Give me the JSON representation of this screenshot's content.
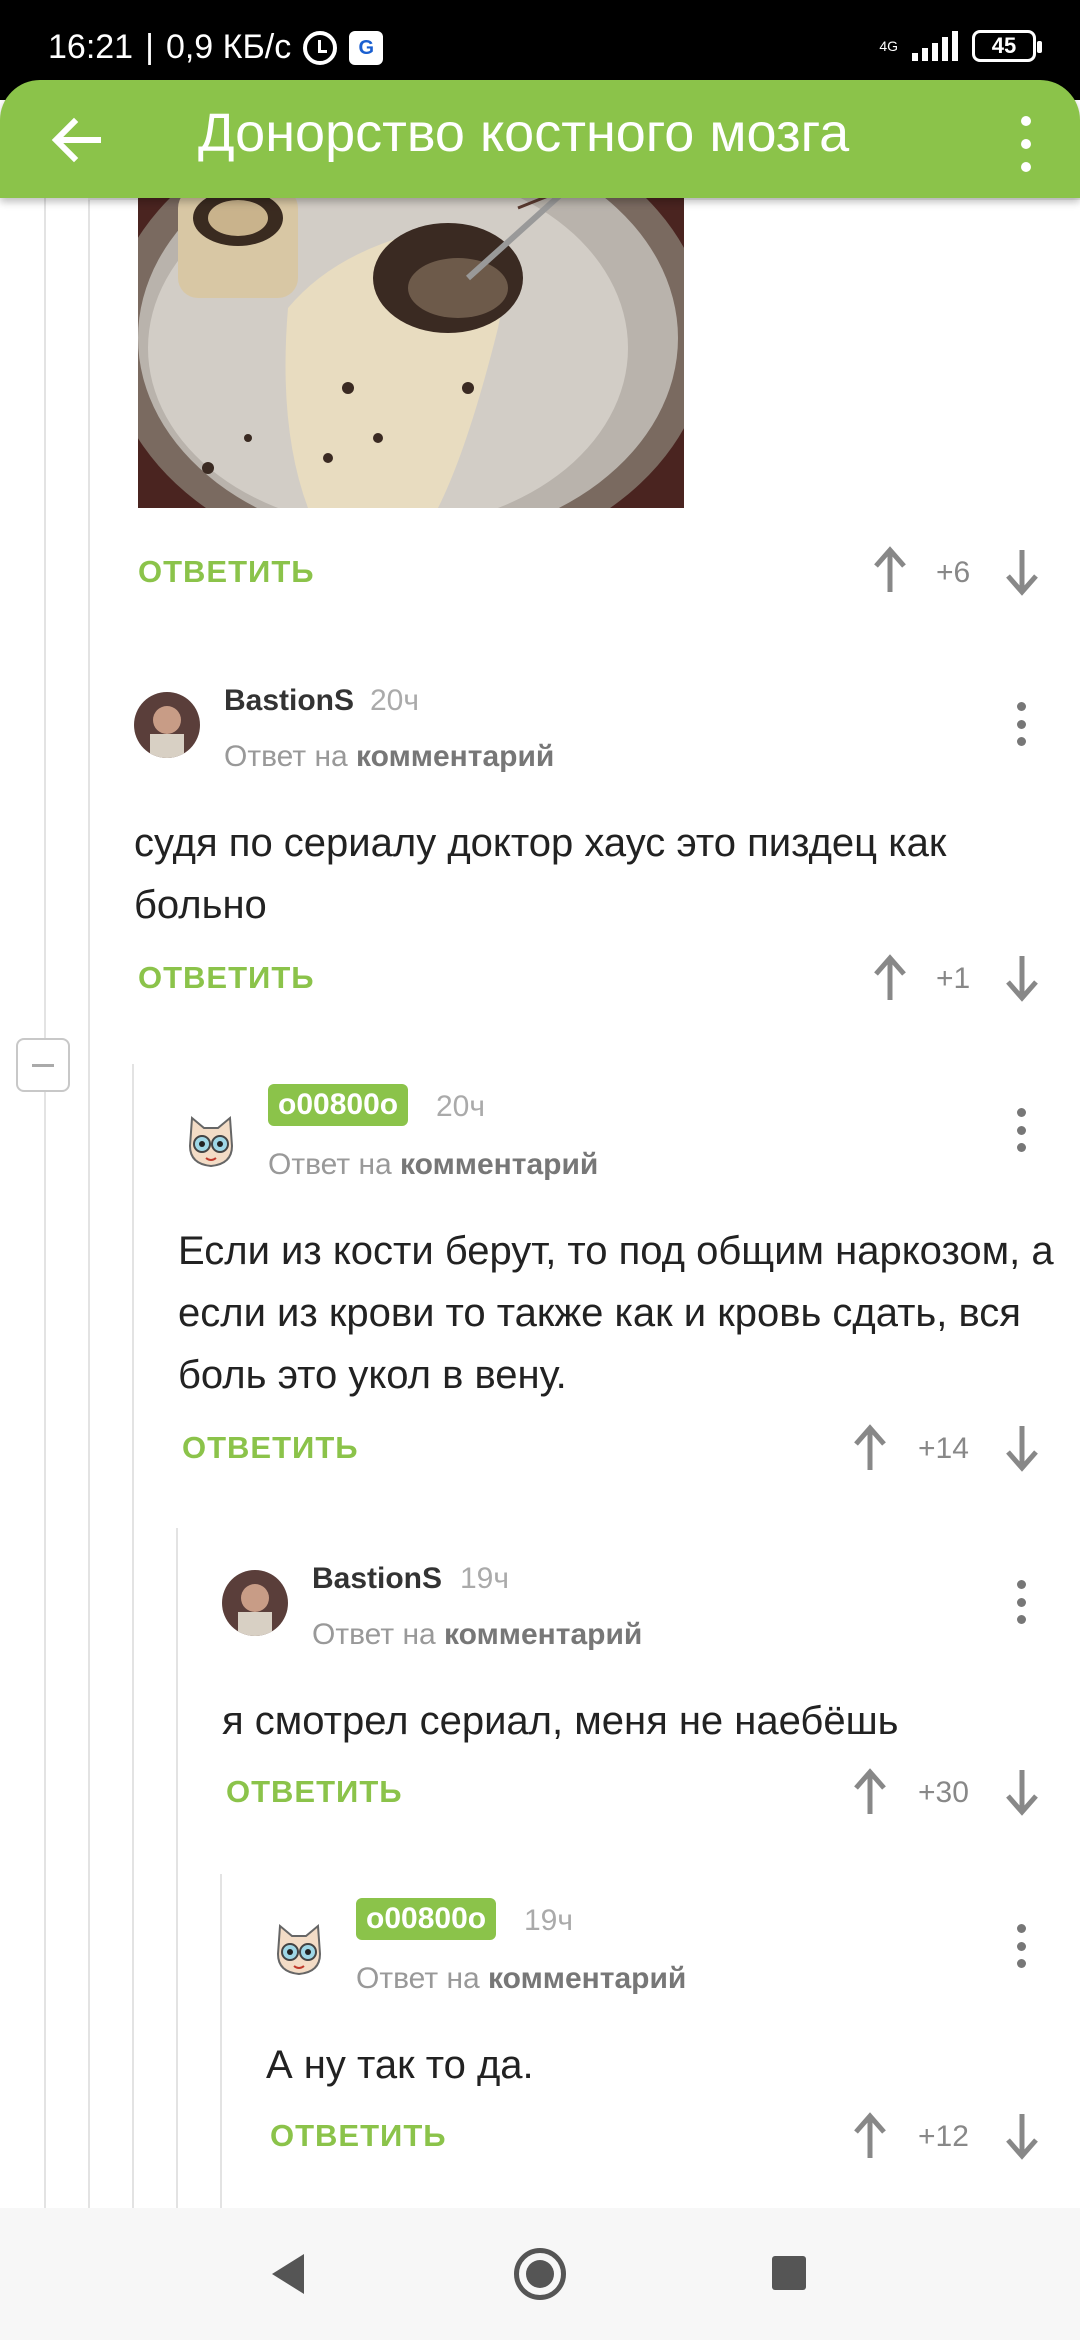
{
  "status_bar": {
    "time": "16:21",
    "speed": "0,9 КБ/с",
    "network": "4G",
    "battery": "45"
  },
  "app_bar": {
    "title": "Донорство костного мозга",
    "accent_color": "#8bc34a"
  },
  "reply_label": "ОТВЕТИТЬ",
  "reply_to_prefix": "Ответ на",
  "reply_to_link": "комментарий",
  "first_item": {
    "image": "bone-marrow-photo",
    "score": "+6"
  },
  "comments": [
    {
      "user": "BastionS",
      "time": "20ч",
      "text": "судя по сериалу доктор хаус это пиздец как больно",
      "score": "+1"
    },
    {
      "user": "o00800o",
      "time": "20ч",
      "text": "Если из кости берут, то под общим наркозом, а если из крови то также как и кровь сдать, вся боль это укол в вену.",
      "score": "+14"
    },
    {
      "user": "BastionS",
      "time": "19ч",
      "text": "я смотрел сериал, меня не наебёшь",
      "score": "+30"
    },
    {
      "user": "o00800o",
      "time": "19ч",
      "text": "А ну так то да.",
      "score": "+12"
    }
  ]
}
